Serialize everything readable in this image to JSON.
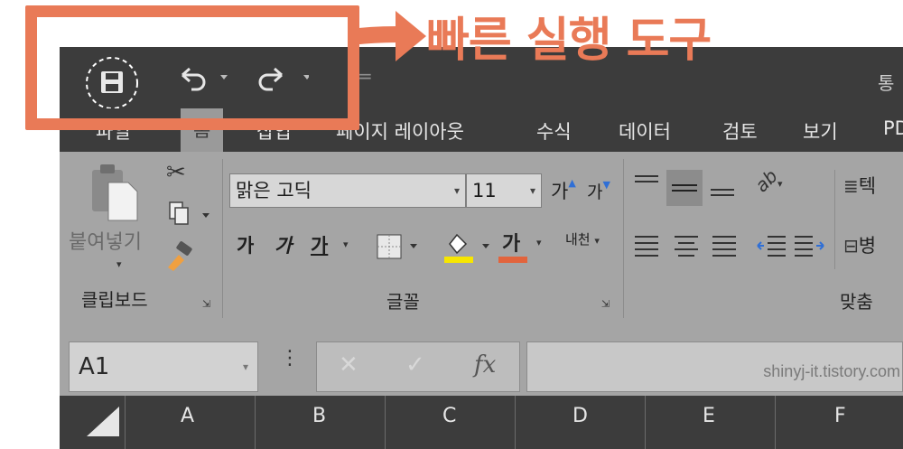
{
  "annotation": {
    "text": "빠른 실행 도구",
    "color": "#e97a57"
  },
  "qat": {
    "save_icon": "save-icon",
    "undo_icon": "undo-icon",
    "redo_icon": "redo-icon",
    "customize": "="
  },
  "window": {
    "title_partial": "통"
  },
  "tabs": [
    "파일",
    "홈",
    "삽입",
    "페이지 레이아웃",
    "수식",
    "데이터",
    "검토",
    "보기",
    "PD"
  ],
  "clipboard": {
    "paste_label": "붙여넣기",
    "group_label": "클립보드"
  },
  "font": {
    "name": "맑은 고딕",
    "size": "11",
    "grow": "가",
    "shrink": "가",
    "bold": "가",
    "italic": "가",
    "underline": "가",
    "color_glyph": "가",
    "phonetic": "내천",
    "group_label": "글꼴"
  },
  "alignment": {
    "group_label": "맞춤",
    "wrap_partial": "텍",
    "merge_partial": "병",
    "orientation": "ab"
  },
  "formula_bar": {
    "name_box": "A1",
    "watermark": "shinyj-it.tistory.com"
  },
  "columns": [
    "A",
    "B",
    "C",
    "D",
    "E",
    "F"
  ]
}
